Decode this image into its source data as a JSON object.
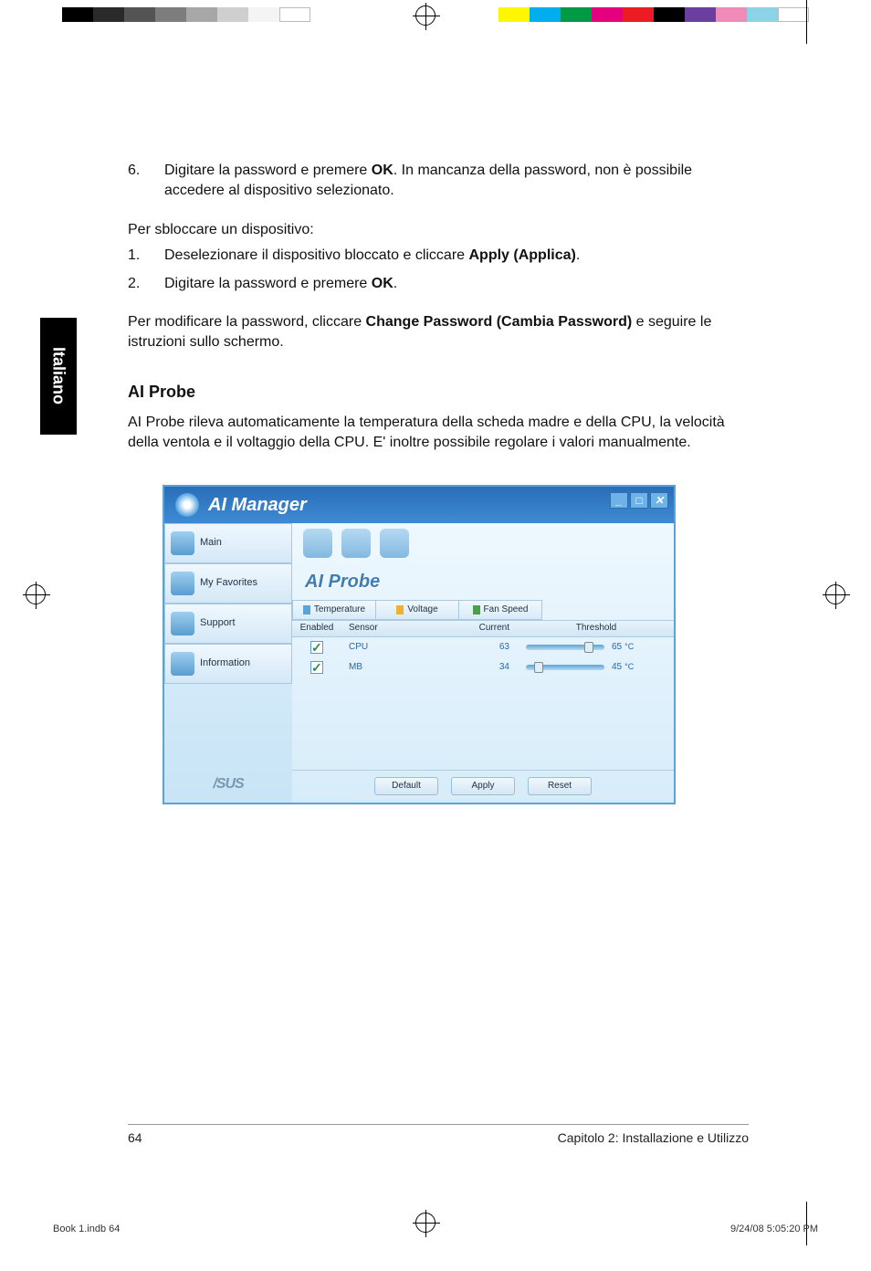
{
  "printmarks": {
    "left_swatches": [
      "#000",
      "#2a2a2a",
      "#545454",
      "#7d7d7d",
      "#a7a7a7",
      "#cfcfcf",
      "#f4f4f4",
      "#fff"
    ],
    "right_swatches": [
      "#fff700",
      "#00aeef",
      "#009944",
      "#e4007f",
      "#ec1c24",
      "#000000",
      "#6b3fa0",
      "#f08ab8",
      "#8cd3e8",
      "#fff"
    ]
  },
  "sideTab": "Italiano",
  "body": {
    "step6_num": "6.",
    "step6_a": "Digitare la password e premere ",
    "step6_b": "OK",
    "step6_c": ". In mancanza della password, non è possibile accedere al dispositivo selezionato.",
    "unblock_intro": "Per sbloccare un dispositivo:",
    "u1_num": "1.",
    "u1_a": "Deselezionare il dispositivo bloccato e cliccare ",
    "u1_b": "Apply (Applica)",
    "u1_c": ".",
    "u2_num": "2.",
    "u2_a": "Digitare la password e premere ",
    "u2_b": "OK",
    "u2_c": ".",
    "chpw_a": "Per modificare la password, cliccare ",
    "chpw_b": "Change Password (Cambia Password)",
    "chpw_c": " e seguire le istruzioni sullo schermo.",
    "section_title": "AI Probe",
    "section_para": "AI Probe rileva automaticamente la temperatura della scheda madre e della CPU, la velocità della ventola e il voltaggio della CPU. E' inoltre possibile regolare i valori manualmente."
  },
  "screenshot": {
    "title": "AI Manager",
    "sidebar": {
      "main": "Main",
      "fav": "My Favorites",
      "support": "Support",
      "info": "Information",
      "brand": "/SUS"
    },
    "panel_title": "AI Probe",
    "tabs": {
      "temp": "Temperature",
      "volt": "Voltage",
      "fan": "Fan Speed"
    },
    "cols": {
      "enabled": "Enabled",
      "sensor": "Sensor",
      "current": "Current",
      "threshold": "Threshold"
    },
    "rows": [
      {
        "sensor": "CPU",
        "current": "63",
        "threshold": "65",
        "unit": "°C",
        "thumb_pct": 74
      },
      {
        "sensor": "MB",
        "current": "34",
        "threshold": "45",
        "unit": "°C",
        "thumb_pct": 10
      }
    ],
    "buttons": {
      "default": "Default",
      "apply": "Apply",
      "reset": "Reset"
    },
    "winbtns": {
      "min": "_",
      "max": "□",
      "close": "✕"
    }
  },
  "footer": {
    "page": "64",
    "chapter": "Capitolo 2: Installazione e Utilizzo"
  },
  "meta": {
    "file": "Book 1.indb   64",
    "date": "9/24/08   5:05:20 PM"
  }
}
